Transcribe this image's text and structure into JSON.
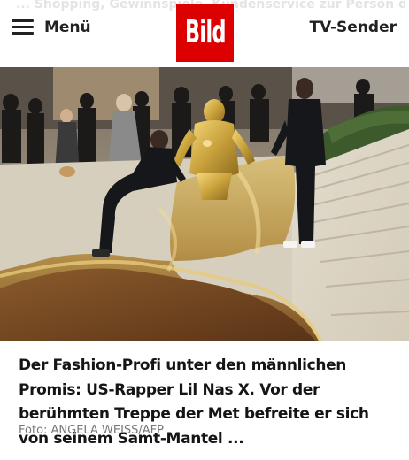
{
  "header": {
    "ghost_text": "... Shopping, Gewinnspiele, Kundenservice zur Person der Pressefreiheit ...",
    "menu_label": "Menü",
    "logo_text": "Bild",
    "tv_link": "TV-Sender"
  },
  "article": {
    "image_alt": "Lil Nas X in goldener Rüstung auf der Treppe der Met Gala",
    "headline": "Der Fashion-Profi unter den männlichen Promis: US-Rapper Lil Nas X. Vor der berühmten Treppe der Met befreite er sich von seinem Samt-Mantel ...",
    "credit": "Foto: ANGELA WEISS/AFP"
  },
  "colors": {
    "brand_red": "#dd0000",
    "text": "#151515",
    "muted": "#777777"
  },
  "icons": {
    "menu": "hamburger-icon"
  }
}
